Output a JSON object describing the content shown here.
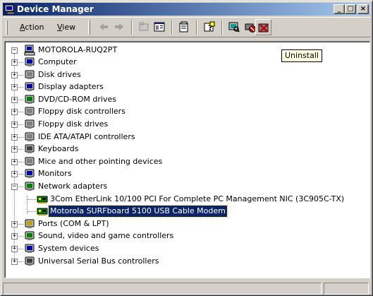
{
  "window": {
    "title": "Device Manager",
    "controls": {
      "minimize": "_",
      "maximize": "□",
      "close": "×"
    }
  },
  "menu": {
    "action": {
      "first": "A",
      "rest": "ction"
    },
    "view": {
      "first": "V",
      "rest": "iew"
    }
  },
  "toolbar": {
    "buttons": [
      "back",
      "forward",
      "up",
      "show-hide-console-tree",
      "properties",
      "help",
      "scan-for-hardware-changes",
      "disable",
      "uninstall"
    ]
  },
  "tooltip": {
    "text": "Uninstall"
  },
  "tree": {
    "root": "MOTOROLA-RUQ2PT",
    "categories": [
      "Computer",
      "Disk drives",
      "Display adapters",
      "DVD/CD-ROM drives",
      "Floppy disk controllers",
      "Floppy disk drives",
      "IDE ATA/ATAPI controllers",
      "Keyboards",
      "Mice and other pointing devices",
      "Monitors",
      "Network adapters",
      "Ports (COM & LPT)",
      "Sound, video and game controllers",
      "System devices",
      "Universal Serial Bus controllers"
    ],
    "network_children": [
      "3Com EtherLink 10/100 PCI For Complete PC Management NIC (3C905C-TX)",
      "Motorola SURFboard 5100 USB Cable Modem"
    ],
    "selected": "Motorola SURFboard 5100 USB Cable Modem",
    "expanded_category": "Network adapters"
  },
  "colors": {
    "titlebar_start": "#0a246a",
    "titlebar_end": "#a6caf0",
    "selection": "#0a246a",
    "tooltip_bg": "#ffffe1"
  }
}
